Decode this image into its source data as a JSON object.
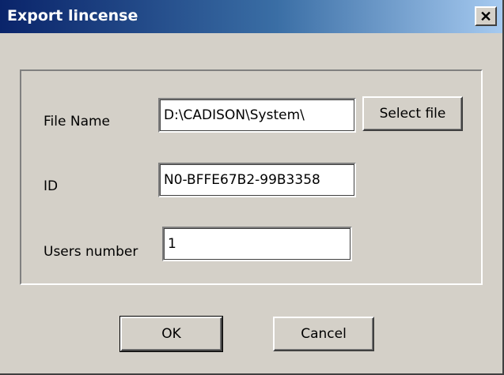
{
  "window": {
    "title": "Export lincense",
    "close_glyph": "✕"
  },
  "form": {
    "file_name": {
      "label": "File Name",
      "value": "D:\\CADISON\\System\\"
    },
    "select_file_label": "Select file",
    "id": {
      "label": "ID",
      "value": "N0-BFFE67B2-99B3358"
    },
    "users_number": {
      "label": "Users number",
      "value": "1"
    }
  },
  "buttons": {
    "ok_label": "OK",
    "cancel_label": "Cancel"
  },
  "colors": {
    "dialog_face": "#d4d0c8",
    "title_start": "#0a246a",
    "title_end": "#a6caf0"
  }
}
